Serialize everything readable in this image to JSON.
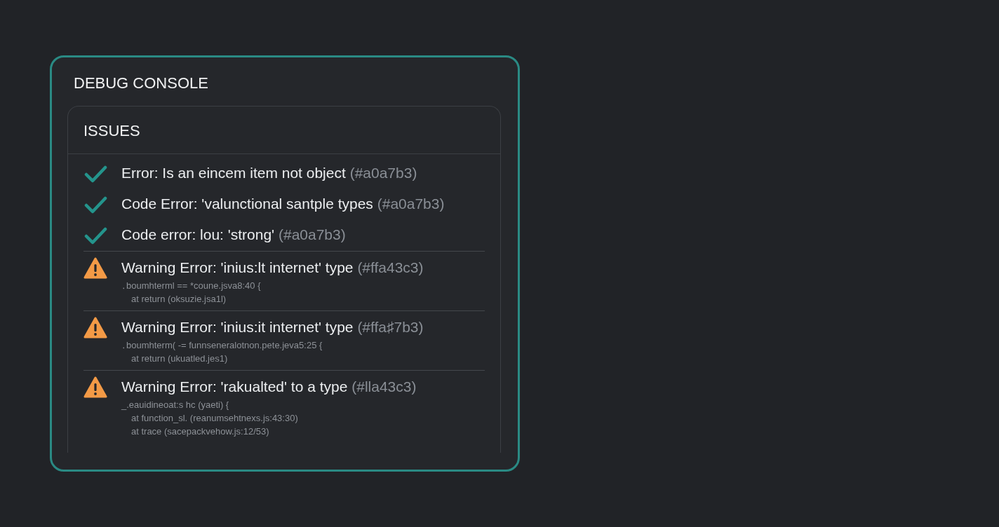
{
  "console": {
    "title": "DEBUG CONSOLE"
  },
  "issues": {
    "title": "ISSUES",
    "items": [
      {
        "kind": "resolved",
        "message": "Error: Is an eincem item not object",
        "code": "(#a0a7b3)"
      },
      {
        "kind": "resolved",
        "message": "Code Error: 'valunctional santple types",
        "code": "(#a0a7b3)"
      },
      {
        "kind": "resolved",
        "message": "Code error: lou: 'strong'",
        "code": "(#a0a7b3)"
      },
      {
        "kind": "warning",
        "message": "Warning Error: 'inius:lt internet' type",
        "code": "(#ffa43c3)",
        "trace": [
          "․boumhterml == *coune.jsva8:40 {",
          "at return (oksuzie.jsa1l)"
        ]
      },
      {
        "kind": "warning",
        "message": "Warning Error: 'inius:it internet' type",
        "code": "(#ffa♯7b3)",
        "trace": [
          "․boumhterm( -= funnseneralotnon.pete.jeva5:25 {",
          "at return (ukuatled.jes1)"
        ]
      },
      {
        "kind": "warning",
        "message": "Warning Error: 'rakualted' to a type",
        "code": "(#lla43c3)",
        "trace": [
          "_.eauidineoat:s hc (yaeti) {",
          "at function_sl. (reanumsehtnexs.js:43:30)",
          "at trace (sacepackvehow.js:12/53)"
        ]
      }
    ]
  }
}
